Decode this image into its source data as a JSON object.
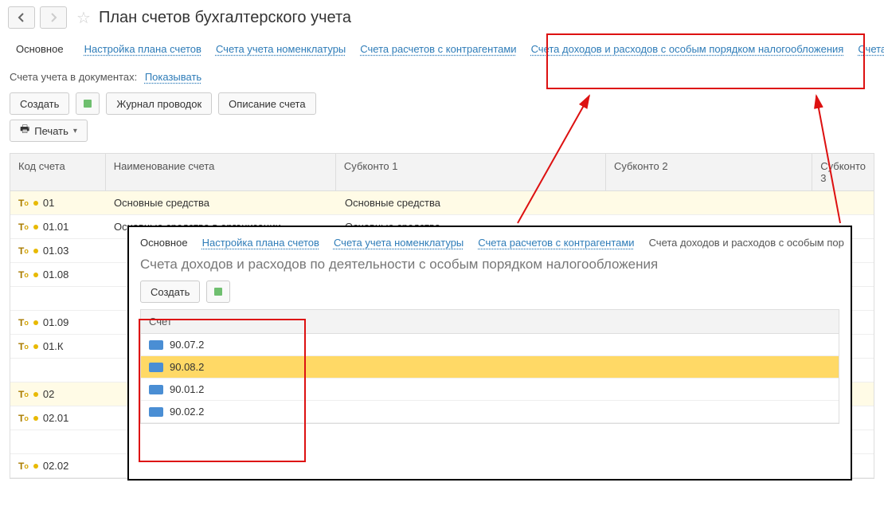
{
  "header": {
    "title": "План счетов бухгалтерского учета"
  },
  "tabs": {
    "main": "Основное",
    "t1": "Настройка плана счетов",
    "t2": "Счета учета номенклатуры",
    "t3": "Счета расчетов с контрагентами",
    "t4": "Счета доходов и расходов с особым порядком налогообложения",
    "t5": "Счета"
  },
  "filter": {
    "label": "Счета учета в документах:",
    "value": "Показывать"
  },
  "toolbar": {
    "create": "Создать",
    "journal": "Журнал проводок",
    "desc": "Описание счета",
    "print": "Печать"
  },
  "columns": {
    "code": "Код счета",
    "name": "Наименование счета",
    "s1": "Субконто 1",
    "s2": "Субконто 2",
    "s3": "Субконто 3"
  },
  "rows": [
    {
      "code": "01",
      "name": "Основные средства",
      "s1": "Основные средства",
      "hl": true
    },
    {
      "code": "01.01",
      "name": "Основные средства в организации",
      "s1": "Основные средства"
    },
    {
      "code": "01.03",
      "name": "",
      "s1": ""
    },
    {
      "code": "01.08",
      "name": "",
      "s1": ""
    },
    {
      "code": "",
      "name": "",
      "s1": ""
    },
    {
      "code": "01.09",
      "name": "",
      "s1": ""
    },
    {
      "code": "01.К",
      "name": "",
      "s1": ""
    },
    {
      "code": "",
      "name": "",
      "s1": ""
    },
    {
      "code": "02",
      "name": "",
      "s1": "",
      "hl": true
    },
    {
      "code": "02.01",
      "name": "",
      "s1": ""
    },
    {
      "code": "",
      "name": "",
      "s1": ""
    },
    {
      "code": "02.02",
      "name": "",
      "s1": ""
    }
  ],
  "popup": {
    "tabs": {
      "main": "Основное",
      "t1": "Настройка плана счетов",
      "t2": "Счета учета номенклатуры",
      "t3": "Счета расчетов с контрагентами",
      "active": "Счета доходов и расходов с особым пор"
    },
    "subtitle": "Счета доходов и расходов по деятельности с особым порядком налогообложения",
    "create": "Создать",
    "col": "Счет",
    "rows": [
      {
        "v": "90.07.2"
      },
      {
        "v": "90.08.2",
        "sel": true
      },
      {
        "v": "90.01.2"
      },
      {
        "v": "90.02.2"
      }
    ]
  }
}
